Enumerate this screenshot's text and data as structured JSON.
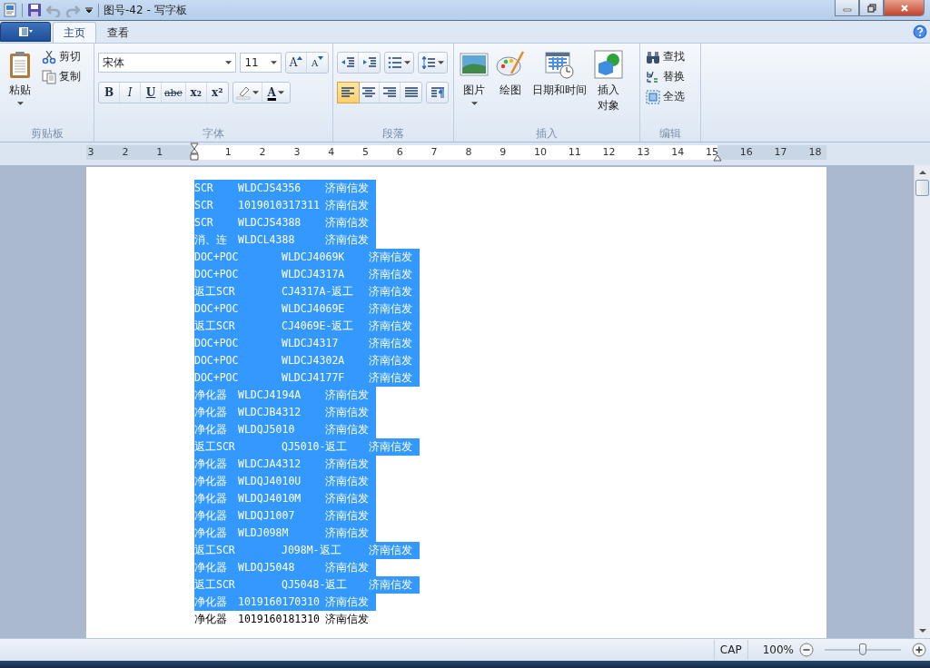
{
  "window": {
    "title": "图号-42 - 写字板"
  },
  "ribbon_tabs": [
    {
      "label": "主页",
      "selected": true
    },
    {
      "label": "查看",
      "selected": false
    }
  ],
  "clipboard": {
    "label": "剪贴板",
    "paste": "粘贴",
    "cut": "剪切",
    "copy": "复制"
  },
  "font": {
    "label": "字体",
    "family": "宋体",
    "size": "11",
    "grow": "A",
    "shrink": "A",
    "bold": "B",
    "italic": "I",
    "underline": "U",
    "strike": "abc",
    "sub": "x₂",
    "sup": "x²",
    "color_letter": "A"
  },
  "paragraph": {
    "label": "段落",
    "align": [
      {
        "kind": "left",
        "selected": true
      },
      {
        "kind": "center",
        "selected": false
      },
      {
        "kind": "right",
        "selected": false
      },
      {
        "kind": "justify",
        "selected": false
      }
    ]
  },
  "insert": {
    "label": "插入",
    "picture": "图片",
    "paint": "绘图",
    "datetime": "日期和时间",
    "object_1": "插入",
    "object_2": "对象"
  },
  "editing": {
    "label": "编辑",
    "find": "查找",
    "replace": "替换",
    "select_all": "全选"
  },
  "ruler": [
    "3",
    "2",
    "1",
    "1",
    "2",
    "3",
    "4",
    "5",
    "6",
    "7",
    "8",
    "9",
    "10",
    "11",
    "12",
    "13",
    "14",
    "15",
    "16",
    "17",
    "18"
  ],
  "document": {
    "lines": [
      {
        "cells": [
          "SCR",
          "WLDCJS4356",
          "济南信发"
        ],
        "selected": true
      },
      {
        "cells": [
          "SCR",
          "1019010317311",
          "济南信发"
        ],
        "selected": true
      },
      {
        "cells": [
          "SCR",
          "WLDCJS4388",
          "济南信发"
        ],
        "selected": true
      },
      {
        "cells": [
          "消、连",
          "WLDCL4388",
          "济南信发"
        ],
        "selected": true
      },
      {
        "cells": [
          "DOC+POC",
          "WLDCJ4069K",
          "济南信发"
        ],
        "selected": true
      },
      {
        "cells": [
          "DOC+POC",
          "WLDCJ4317A",
          "济南信发"
        ],
        "selected": true
      },
      {
        "cells": [
          "返工SCR",
          "CJ4317A-返工",
          "济南信发"
        ],
        "selected": true
      },
      {
        "cells": [
          "DOC+POC",
          "WLDCJ4069E",
          "济南信发"
        ],
        "selected": true
      },
      {
        "cells": [
          "返工SCR",
          "CJ4069E-返工",
          "济南信发"
        ],
        "selected": true
      },
      {
        "cells": [
          "DOC+POC",
          "WLDCJ4317",
          "济南信发"
        ],
        "selected": true
      },
      {
        "cells": [
          "DOC+POC",
          "WLDCJ4302A",
          "济南信发"
        ],
        "selected": true
      },
      {
        "cells": [
          "DOC+POC",
          "WLDCJ4177F",
          "济南信发"
        ],
        "selected": true
      },
      {
        "cells": [
          "净化器",
          "WLDCJ4194A",
          "济南信发"
        ],
        "selected": true
      },
      {
        "cells": [
          "净化器",
          "WLDCJB4312",
          "济南信发"
        ],
        "selected": true
      },
      {
        "cells": [
          "净化器",
          "WLDQJ5010",
          "济南信发"
        ],
        "selected": true
      },
      {
        "cells": [
          "返工SCR",
          "QJ5010-返工",
          "济南信发"
        ],
        "selected": true
      },
      {
        "cells": [
          "净化器",
          "WLDCJA4312",
          "济南信发"
        ],
        "selected": true
      },
      {
        "cells": [
          "净化器",
          "WLDQJ4010U",
          "济南信发"
        ],
        "selected": true
      },
      {
        "cells": [
          "净化器",
          "WLDQJ4010M",
          "济南信发"
        ],
        "selected": true
      },
      {
        "cells": [
          "净化器",
          "WLDQJ1007",
          "济南信发"
        ],
        "selected": true
      },
      {
        "cells": [
          "净化器",
          "WLDJ098M",
          "济南信发"
        ],
        "selected": true
      },
      {
        "cells": [
          "返工SCR",
          "J098M-返工",
          "济南信发"
        ],
        "selected": true
      },
      {
        "cells": [
          "净化器",
          "WLDQJ5048",
          "济南信发"
        ],
        "selected": true
      },
      {
        "cells": [
          "返工SCR",
          "QJ5048-返工",
          "济南信发"
        ],
        "selected": true
      },
      {
        "cells": [
          "净化器",
          "1019160170310",
          "济南信发"
        ],
        "selected": true
      },
      {
        "cells": [
          "净化器",
          "1019160181310",
          "济南信发"
        ],
        "selected": false
      }
    ]
  },
  "status_bar": {
    "caps": "CAP",
    "zoom": "100%",
    "zoom_slider": {
      "level": 0.5
    }
  }
}
